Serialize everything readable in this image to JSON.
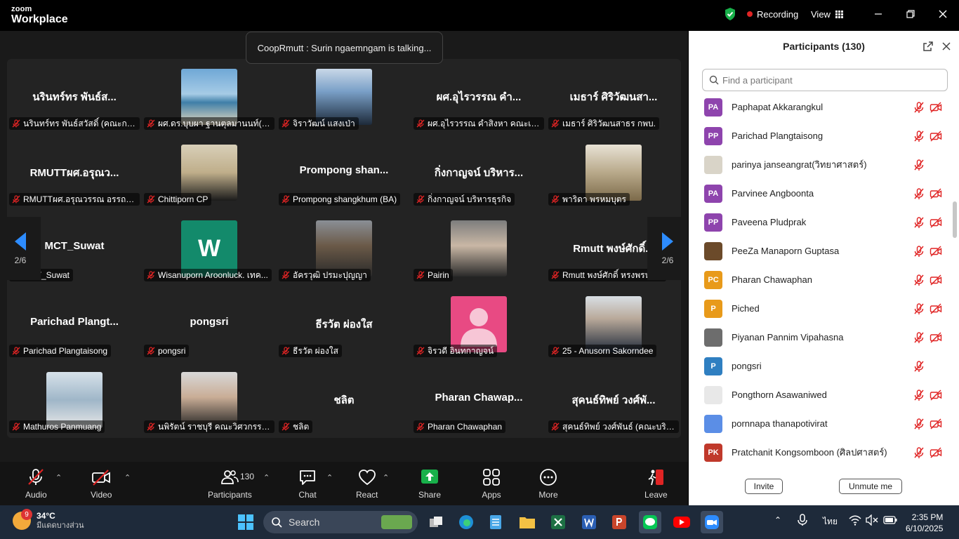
{
  "titlebar": {
    "logo_line1": "zoom",
    "logo_line2": "Workplace",
    "recording_label": "Recording",
    "view_label": "View"
  },
  "banner": {
    "talking": "CoopRmutt : Surin ngaemngam is talking..."
  },
  "grid": {
    "tiles": [
      {
        "big": "นรินทร์ทร พันธ์ส...",
        "label": "นรินทร์ทร พันธ์สวัสดิ์ (คณะการ..."
      },
      {
        "big": "",
        "label": "ผศ.ดร.บุบผา ฐานตุลมานนท์(บริ..."
      },
      {
        "big": "",
        "label": "จิราวัฒน์ แสงเป่า"
      },
      {
        "big": "ผศ.อุไรวรรณ คำ...",
        "label": "ผศ.อุไรวรรณ คำสิงหา คณะเทคโ..."
      },
      {
        "big": "เมธาร์ ศิริวัฒนสา...",
        "label": "เมธาร์ ศิริวัฒนสาธร กพบ."
      },
      {
        "big": "RMUTTผศ.อรุณว...",
        "label": "RMUTTผศ.อรุณวรรณ อรรถธ..."
      },
      {
        "big": "",
        "label": "Chittiporn CP"
      },
      {
        "big": "Prompong  shan...",
        "label": "Prompong shangkhum (BA)"
      },
      {
        "big": "กิ่งกาญจน์ บริหาร...",
        "label": "กิ่งกาญจน์ บริหารธุรกิจ"
      },
      {
        "big": "",
        "label": "พาริดา พรหมบุตร"
      },
      {
        "big": "MCT_Suwat",
        "label": "MCT_Suwat"
      },
      {
        "big": "",
        "label": "Wisanuporn Aroonluck. เทค...",
        "initial": "W"
      },
      {
        "big": "",
        "label": "อัครวุฒิ ปรมะปุญญา"
      },
      {
        "big": "",
        "label": "Pairin"
      },
      {
        "big": "Rmutt พงษ์ศักดิ์...",
        "label": "Rmutt พงษ์ศักดิ์ หรงพรหม..."
      },
      {
        "big": "Parichad  Plangt...",
        "label": "Parichad Plangtaisong"
      },
      {
        "big": "pongsri",
        "label": "pongsri"
      },
      {
        "big": "ธีรวัต  ผ่องใส",
        "label": "ธีรวัต  ผ่องใส"
      },
      {
        "big": "",
        "label": "จิรวดี อินทกาญจน์"
      },
      {
        "big": "",
        "label": "25 - Anusorn Sakorndee"
      },
      {
        "big": "",
        "label": "Mathuros Panmuang"
      },
      {
        "big": "",
        "label": "นพิรัตน์ ราชบุรี คณะวิศวกรรมศ..."
      },
      {
        "big": "ชลิต",
        "label": "ชลิต"
      },
      {
        "big": "Pharan  Chawap...",
        "label": "Pharan Chawaphan"
      },
      {
        "big": "สุคนธ์ทิพย์ วงศ์พั...",
        "label": "สุคนธ์ทิพย์ วงศ์พันธ์ (คณะบริหา..."
      }
    ],
    "page_left": "2/6",
    "page_right": "2/6"
  },
  "toolbar": {
    "audio": "Audio",
    "video": "Video",
    "participants": "Participants",
    "participants_count": "130",
    "chat": "Chat",
    "react": "React",
    "share": "Share",
    "apps": "Apps",
    "more": "More",
    "leave": "Leave"
  },
  "panel": {
    "title": "Participants (130)",
    "search_placeholder": "Find a participant",
    "invite": "Invite",
    "unmute_me": "Unmute me",
    "participants": [
      {
        "initials": "PA",
        "name": "Paphapat Akkarangkul",
        "color": "#8e44ad",
        "video": true
      },
      {
        "initials": "PP",
        "name": "Parichad Plangtaisong",
        "color": "#8e44ad",
        "video": true
      },
      {
        "initials": "",
        "name": "parinya janseangrat(วิทยาศาสตร์)",
        "color": "#d9d4c8",
        "video": false
      },
      {
        "initials": "PA",
        "name": "Parvinee Angboonta",
        "color": "#8e44ad",
        "video": true
      },
      {
        "initials": "PP",
        "name": "Paveena  Pludprak",
        "color": "#8e44ad",
        "video": true
      },
      {
        "initials": "",
        "name": "PeeZa Manaporn Guptasa",
        "color": "#6b4a2a",
        "video": true
      },
      {
        "initials": "PC",
        "name": "Pharan Chawaphan",
        "color": "#e89a1a",
        "video": true
      },
      {
        "initials": "P",
        "name": "Piched",
        "color": "#e89a1a",
        "video": true
      },
      {
        "initials": "",
        "name": "Piyanan Pannim Vipahasna",
        "color": "#6d6d6d",
        "video": true
      },
      {
        "initials": "P",
        "name": "pongsri",
        "color": "#2f7fc1",
        "video": false
      },
      {
        "initials": "",
        "name": "Pongthorn Asawaniwed",
        "color": "#e8e8e8",
        "video": true
      },
      {
        "initials": "",
        "name": "pornnapa thanapotivirat",
        "color": "#5b8ee6",
        "video": true
      },
      {
        "initials": "PK",
        "name": "Pratchanit Kongsomboon (ศิลปศาสตร์)",
        "color": "#c0392b",
        "video": true
      }
    ]
  },
  "taskbar": {
    "temp": "34°C",
    "weather": "มีแดดบางส่วน",
    "weather_badge": "9",
    "search": "Search",
    "lang": "ไทย",
    "time": "2:35 PM",
    "date": "6/10/2025"
  }
}
